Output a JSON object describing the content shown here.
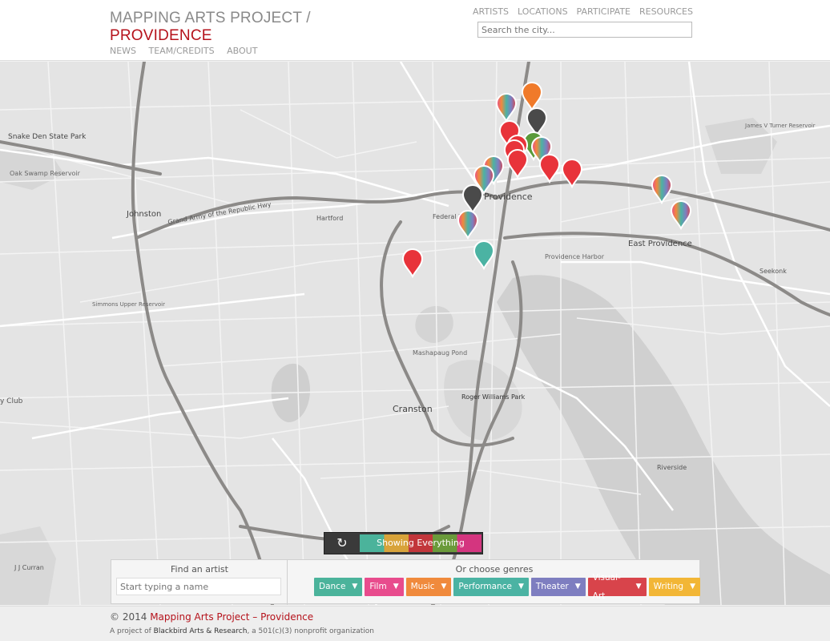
{
  "header": {
    "brand_line1": "MAPPING ARTS PROJECT /",
    "brand_line2": "PROVIDENCE",
    "subnav": [
      "NEWS",
      "TEAM/CREDITS",
      "ABOUT"
    ],
    "mainnav": [
      "ARTISTS",
      "LOCATIONS",
      "PARTICIPATE",
      "RESOURCES"
    ],
    "search_placeholder": "Search the city..."
  },
  "map": {
    "labels": {
      "providence": "Providence",
      "east_providence": "East Providence",
      "cranston": "Cranston",
      "johnston": "Johnston",
      "snake_den": "Snake Den State Park",
      "oak_swamp": "Oak Swamp Reservoir",
      "roger_williams": "Roger Williams Park",
      "providence_harbor": "Providence Harbor",
      "mashapaug": "Mashapaug Pond",
      "hartford": "Hartford",
      "grand_army": "Grand Army of the Republic Hwy",
      "federal_hill": "Federal Hill",
      "seekonk": "Seekonk",
      "riverside": "Riverside",
      "james_turner": "James V Turner Reservoir",
      "simmons": "Simmons Upper Reservoir",
      "club": "y Club",
      "jj_curran": "J J Curran"
    },
    "marker_colors": {
      "red": "#e8333a",
      "orange": "#f07a2a",
      "dark": "#4a4a4a",
      "teal": "#4bb3a3",
      "green": "#5a9a3a"
    }
  },
  "toggle": {
    "refresh_icon": "refresh-icon",
    "label": "Showing Everything"
  },
  "finder": {
    "title": "Find an artist",
    "placeholder": "Start typing a name"
  },
  "genres": {
    "title": "Or choose genres",
    "items": [
      {
        "label": "Dance",
        "color": "#4bb39b"
      },
      {
        "label": "Film",
        "color": "#e84c8d"
      },
      {
        "label": "Music",
        "color": "#f08a3c"
      },
      {
        "label": "Performance",
        "color": "#4bb3a3"
      },
      {
        "label": "Theater",
        "color": "#7e7ec0"
      },
      {
        "label": "Visual-Art",
        "color": "#d8444b"
      },
      {
        "label": "Writing",
        "color": "#f2b636"
      }
    ]
  },
  "footer": {
    "copyright_prefix": "© 2014",
    "copyright_name": "Mapping Arts Project – Providence",
    "credit_prefix": "A project of",
    "credit_org": "Blackbird Arts & Research",
    "credit_suffix": ", a 501(c)(3) nonprofit organization"
  }
}
